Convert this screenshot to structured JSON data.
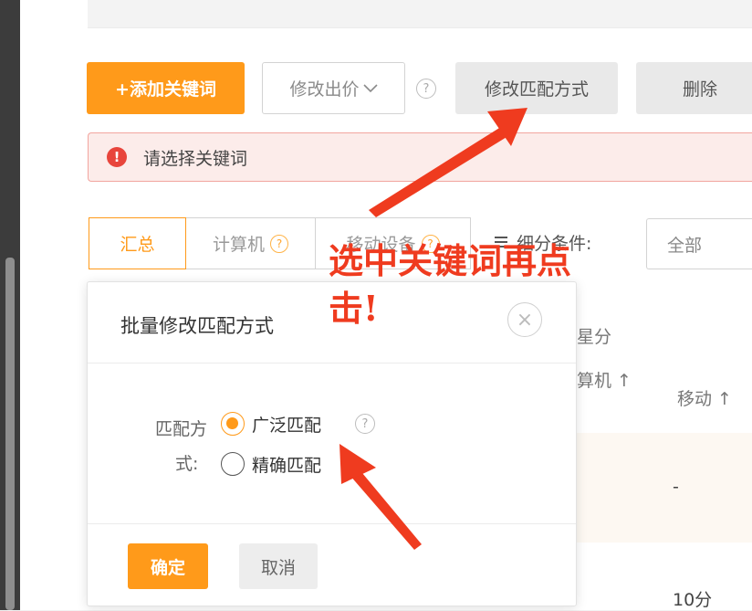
{
  "toolbar": {
    "add_keyword_label": "+添加关键词",
    "modify_bid_label": "修改出价",
    "modify_match_label": "修改匹配方式",
    "delete_label": "删除"
  },
  "alert": {
    "icon_text": "!",
    "message": "请选择关键词"
  },
  "tabs": [
    {
      "label": "汇总"
    },
    {
      "label": "计算机"
    },
    {
      "label": "移动设备"
    }
  ],
  "filter": {
    "label": "细分条件:",
    "value": "全部"
  },
  "table": {
    "header_group": "星分",
    "col_computer": "算机 ↑",
    "col_mobile": "移动 ↑",
    "cell_dash": "-",
    "cell_score": "10分"
  },
  "dialog": {
    "title": "批量修改匹配方式",
    "close_symbol": "×",
    "field_label_line1": "匹配方",
    "field_label_line2": "式:",
    "option_broad": "广泛匹配",
    "option_exact": "精确匹配",
    "selected": "广泛匹配",
    "confirm_label": "确定",
    "cancel_label": "取消"
  },
  "annotation": {
    "line1": "选中关键词再点",
    "line2": "击!",
    "color": "#ef3b1f"
  },
  "colors": {
    "accent": "#ff9a1a",
    "alert_red": "#e8453c"
  },
  "icons": {
    "help": "?",
    "dropdown": "chevron-down-icon"
  }
}
